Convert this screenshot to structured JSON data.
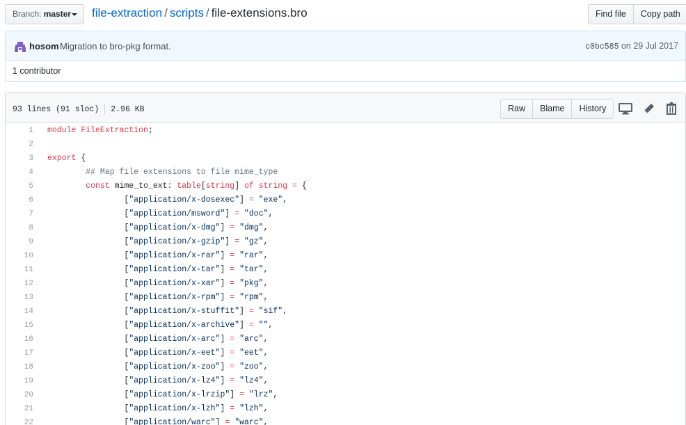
{
  "branch": {
    "label": "Branch:",
    "value": "master"
  },
  "breadcrumb": {
    "repo": "file-extraction",
    "sep1": "/",
    "folder": "scripts",
    "sep2": "/",
    "file": "file-extensions.bro"
  },
  "actions": {
    "find_file": "Find file",
    "copy_path": "Copy path"
  },
  "commit": {
    "author": "hosom",
    "message": "Migration to bro-pkg format.",
    "sha": "c0bc585",
    "date_prefix": "on",
    "date": "29 Jul 2017"
  },
  "contributors": "1 contributor",
  "file": {
    "lines_info": "93 lines (91 sloc)",
    "size": "2.96 KB",
    "raw": "Raw",
    "blame": "Blame",
    "history": "History"
  },
  "icons": [
    "desktop-icon",
    "pencil-icon",
    "trash-icon",
    "avatar-icon",
    "caret-down-icon"
  ],
  "colors": {
    "link": "#0366d6",
    "keyword": "#d73a49",
    "string": "#032f62",
    "comment": "#6a737d",
    "commit_bg": "#f1f8ff"
  },
  "code_lines": [
    {
      "n": "1",
      "segs": [
        [
          "kw",
          "module"
        ],
        [
          "",
          " "
        ],
        [
          "kw",
          "FileExtraction"
        ],
        [
          "",
          ";"
        ]
      ]
    },
    {
      "n": "2",
      "segs": []
    },
    {
      "n": "3",
      "segs": [
        [
          "kw",
          "export"
        ],
        [
          "",
          " {"
        ]
      ]
    },
    {
      "n": "4",
      "segs": [
        [
          "",
          "\t"
        ],
        [
          "cmt",
          "## Map file extensions to file mime_type"
        ]
      ]
    },
    {
      "n": "5",
      "segs": [
        [
          "",
          "\t"
        ],
        [
          "kw",
          "const"
        ],
        [
          "",
          " mime_to_ext: "
        ],
        [
          "kw",
          "table"
        ],
        [
          "",
          "["
        ],
        [
          "kw",
          "string"
        ],
        [
          "",
          "] "
        ],
        [
          "kw",
          "of"
        ],
        [
          "",
          " "
        ],
        [
          "kw",
          "string"
        ],
        [
          "",
          " "
        ],
        [
          "kw",
          "="
        ],
        [
          "",
          " {"
        ]
      ]
    },
    {
      "n": "6",
      "segs": [
        [
          "",
          "\t\t["
        ],
        [
          "str",
          "\"application/x-dosexec\""
        ],
        [
          "",
          "] "
        ],
        [
          "kw",
          "="
        ],
        [
          "",
          " "
        ],
        [
          "str",
          "\"exe\""
        ],
        [
          "",
          ","
        ]
      ]
    },
    {
      "n": "7",
      "segs": [
        [
          "",
          "\t\t["
        ],
        [
          "str",
          "\"application/msword\""
        ],
        [
          "",
          "] "
        ],
        [
          "kw",
          "="
        ],
        [
          "",
          " "
        ],
        [
          "str",
          "\"doc\""
        ],
        [
          "",
          ","
        ]
      ]
    },
    {
      "n": "8",
      "segs": [
        [
          "",
          "\t\t["
        ],
        [
          "str",
          "\"application/x-dmg\""
        ],
        [
          "",
          "] "
        ],
        [
          "kw",
          "="
        ],
        [
          "",
          " "
        ],
        [
          "str",
          "\"dmg\""
        ],
        [
          "",
          ","
        ]
      ]
    },
    {
      "n": "9",
      "segs": [
        [
          "",
          "\t\t["
        ],
        [
          "str",
          "\"application/x-gzip\""
        ],
        [
          "",
          "] "
        ],
        [
          "kw",
          "="
        ],
        [
          "",
          " "
        ],
        [
          "str",
          "\"gz\""
        ],
        [
          "",
          ","
        ]
      ]
    },
    {
      "n": "10",
      "segs": [
        [
          "",
          "\t\t["
        ],
        [
          "str",
          "\"application/x-rar\""
        ],
        [
          "",
          "] "
        ],
        [
          "kw",
          "="
        ],
        [
          "",
          " "
        ],
        [
          "str",
          "\"rar\""
        ],
        [
          "",
          ","
        ]
      ]
    },
    {
      "n": "11",
      "segs": [
        [
          "",
          "\t\t["
        ],
        [
          "str",
          "\"application/x-tar\""
        ],
        [
          "",
          "] "
        ],
        [
          "kw",
          "="
        ],
        [
          "",
          " "
        ],
        [
          "str",
          "\"tar\""
        ],
        [
          "",
          ","
        ]
      ]
    },
    {
      "n": "12",
      "segs": [
        [
          "",
          "\t\t["
        ],
        [
          "str",
          "\"application/x-xar\""
        ],
        [
          "",
          "] "
        ],
        [
          "kw",
          "="
        ],
        [
          "",
          " "
        ],
        [
          "str",
          "\"pkg\""
        ],
        [
          "",
          ","
        ]
      ]
    },
    {
      "n": "13",
      "segs": [
        [
          "",
          "\t\t["
        ],
        [
          "str",
          "\"application/x-rpm\""
        ],
        [
          "",
          "] "
        ],
        [
          "kw",
          "="
        ],
        [
          "",
          " "
        ],
        [
          "str",
          "\"rpm\""
        ],
        [
          "",
          ","
        ]
      ]
    },
    {
      "n": "14",
      "segs": [
        [
          "",
          "\t\t["
        ],
        [
          "str",
          "\"application/x-stuffit\""
        ],
        [
          "",
          "] "
        ],
        [
          "kw",
          "="
        ],
        [
          "",
          " "
        ],
        [
          "str",
          "\"sif\""
        ],
        [
          "",
          ","
        ]
      ]
    },
    {
      "n": "15",
      "segs": [
        [
          "",
          "\t\t["
        ],
        [
          "str",
          "\"application/x-archive\""
        ],
        [
          "",
          "] "
        ],
        [
          "kw",
          "="
        ],
        [
          "",
          " "
        ],
        [
          "str",
          "\"\""
        ],
        [
          "",
          ","
        ]
      ]
    },
    {
      "n": "16",
      "segs": [
        [
          "",
          "\t\t["
        ],
        [
          "str",
          "\"application/x-arc\""
        ],
        [
          "",
          "] "
        ],
        [
          "kw",
          "="
        ],
        [
          "",
          " "
        ],
        [
          "str",
          "\"arc\""
        ],
        [
          "",
          ","
        ]
      ]
    },
    {
      "n": "17",
      "segs": [
        [
          "",
          "\t\t["
        ],
        [
          "str",
          "\"application/x-eet\""
        ],
        [
          "",
          "] "
        ],
        [
          "kw",
          "="
        ],
        [
          "",
          " "
        ],
        [
          "str",
          "\"eet\""
        ],
        [
          "",
          ","
        ]
      ]
    },
    {
      "n": "18",
      "segs": [
        [
          "",
          "\t\t["
        ],
        [
          "str",
          "\"application/x-zoo\""
        ],
        [
          "",
          "] "
        ],
        [
          "kw",
          "="
        ],
        [
          "",
          " "
        ],
        [
          "str",
          "\"zoo\""
        ],
        [
          "",
          ","
        ]
      ]
    },
    {
      "n": "19",
      "segs": [
        [
          "",
          "\t\t["
        ],
        [
          "str",
          "\"application/x-lz4\""
        ],
        [
          "",
          "] "
        ],
        [
          "kw",
          "="
        ],
        [
          "",
          " "
        ],
        [
          "str",
          "\"lz4\""
        ],
        [
          "",
          ","
        ]
      ]
    },
    {
      "n": "20",
      "segs": [
        [
          "",
          "\t\t["
        ],
        [
          "str",
          "\"application/x-lrzip\""
        ],
        [
          "",
          "] "
        ],
        [
          "kw",
          "="
        ],
        [
          "",
          " "
        ],
        [
          "str",
          "\"lrz\""
        ],
        [
          "",
          ","
        ]
      ]
    },
    {
      "n": "21",
      "segs": [
        [
          "",
          "\t\t["
        ],
        [
          "str",
          "\"application/x-lzh\""
        ],
        [
          "",
          "] "
        ],
        [
          "kw",
          "="
        ],
        [
          "",
          " "
        ],
        [
          "str",
          "\"lzh\""
        ],
        [
          "",
          ","
        ]
      ]
    },
    {
      "n": "22",
      "segs": [
        [
          "",
          "\t\t["
        ],
        [
          "str",
          "\"application/warc\""
        ],
        [
          "",
          "] "
        ],
        [
          "kw",
          "="
        ],
        [
          "",
          " "
        ],
        [
          "str",
          "\"warc\""
        ],
        [
          "",
          ","
        ]
      ]
    }
  ]
}
